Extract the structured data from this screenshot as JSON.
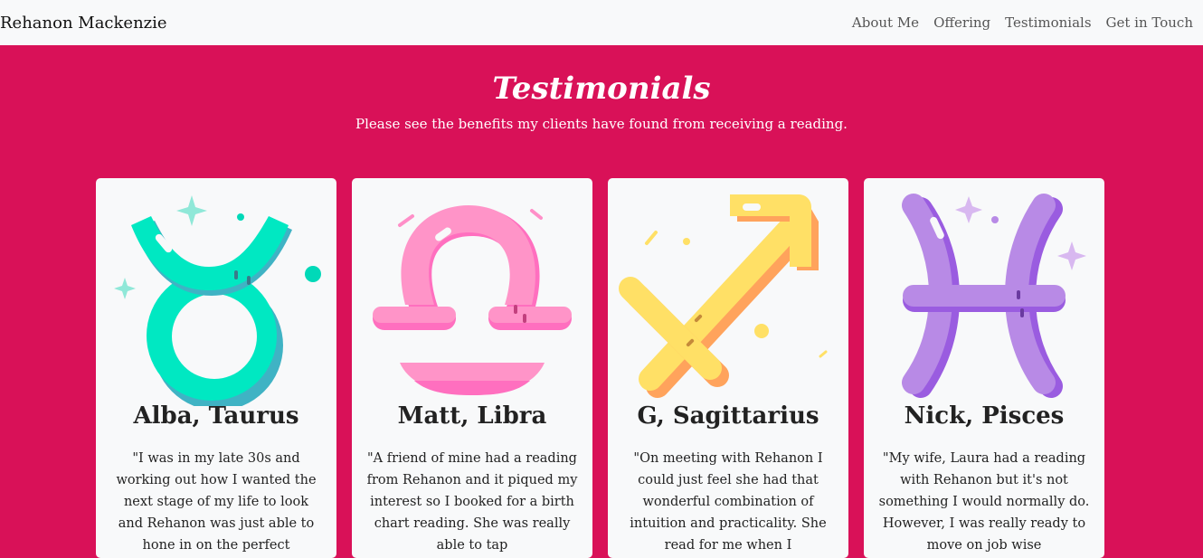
{
  "navbar": {
    "brand": "Rehanon Mackenzie",
    "links": [
      "About Me",
      "Offering",
      "Testimonials",
      "Get in Touch"
    ]
  },
  "section": {
    "title": "Testimonials",
    "subtitle": "Please see the benefits my clients have found from receiving a reading."
  },
  "cards": [
    {
      "name": "Alba, Taurus",
      "icon": "taurus-icon",
      "quote": "\"I was in my late 30s and working out how I wanted the next stage of my life to look and Rehanon was just able to hone in on the perfect"
    },
    {
      "name": "Matt, Libra",
      "icon": "libra-icon",
      "quote": "\"A friend of mine had a reading from Rehanon and it piqued my interest so I booked for a birth chart reading. She was really able to tap"
    },
    {
      "name": "G, Sagittarius",
      "icon": "sagittarius-icon",
      "quote": "\"On meeting with Rehanon I could just feel she had that wonderful combination of intuition and practicality. She read for me when I"
    },
    {
      "name": "Nick, Pisces",
      "icon": "pisces-icon",
      "quote": "\"My wife, Laura had a reading with Rehanon but it's not something I would normally do. However, I was really ready to move on job wise"
    }
  ],
  "colors": {
    "hero_bg": "#d91158",
    "navbar_bg": "#f8f9fa",
    "card_bg": "#f8f9fa"
  }
}
